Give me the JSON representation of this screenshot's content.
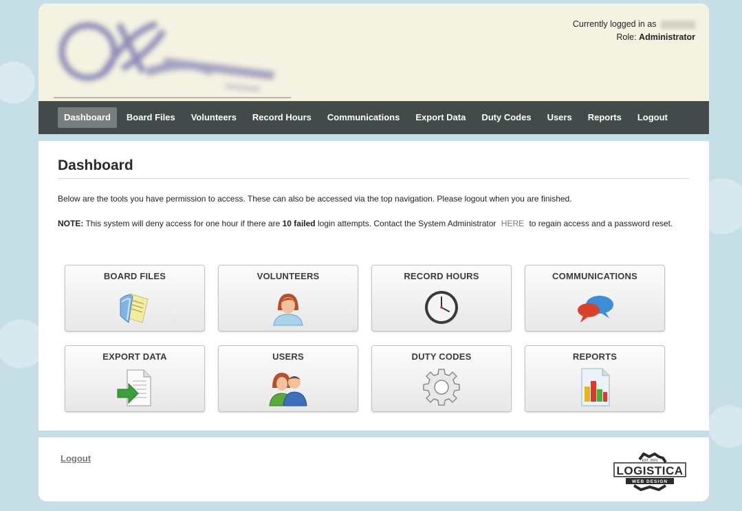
{
  "header": {
    "logged_in_label": "Currently logged in as",
    "role_label": "Role:",
    "role_value": "Administrator"
  },
  "nav": {
    "items": [
      {
        "label": "Dashboard"
      },
      {
        "label": "Board Files"
      },
      {
        "label": "Volunteers"
      },
      {
        "label": "Record Hours"
      },
      {
        "label": "Communications"
      },
      {
        "label": "Export Data"
      },
      {
        "label": "Duty Codes"
      },
      {
        "label": "Users"
      },
      {
        "label": "Reports"
      },
      {
        "label": "Logout"
      }
    ],
    "active": "Dashboard"
  },
  "main": {
    "title": "Dashboard",
    "intro": "Below are the tools you have permission to access. These can also be accessed via the top navigation. Please logout when you are finished.",
    "note_label": "NOTE:",
    "note_text_1": "This system will deny access for one hour if there are",
    "note_bold": "10 failed",
    "note_text_2": "login attempts. Contact the System Administrator",
    "note_link": "HERE",
    "note_text_3": "to regain access and a password reset."
  },
  "tiles": [
    {
      "label": "BOARD FILES",
      "icon": "folder-icon"
    },
    {
      "label": "VOLUNTEERS",
      "icon": "volunteer-icon"
    },
    {
      "label": "RECORD HOURS",
      "icon": "clock-icon"
    },
    {
      "label": "COMMUNICATIONS",
      "icon": "chat-bubbles-icon"
    },
    {
      "label": "EXPORT DATA",
      "icon": "export-document-icon"
    },
    {
      "label": "USERS",
      "icon": "users-icon"
    },
    {
      "label": "DUTY CODES",
      "icon": "gear-icon"
    },
    {
      "label": "REPORTS",
      "icon": "report-chart-icon"
    }
  ],
  "footer": {
    "logout": "Logout",
    "brand_name": "LOGISTICA",
    "brand_tagline": "WEB DESIGN",
    "brand_est": "EST. 2001"
  },
  "colors": {
    "nav_bg": "#424b4a",
    "nav_active": "#777e7d",
    "header_bg": "#f4f3e2",
    "page_bg": "#c6dfe6"
  }
}
